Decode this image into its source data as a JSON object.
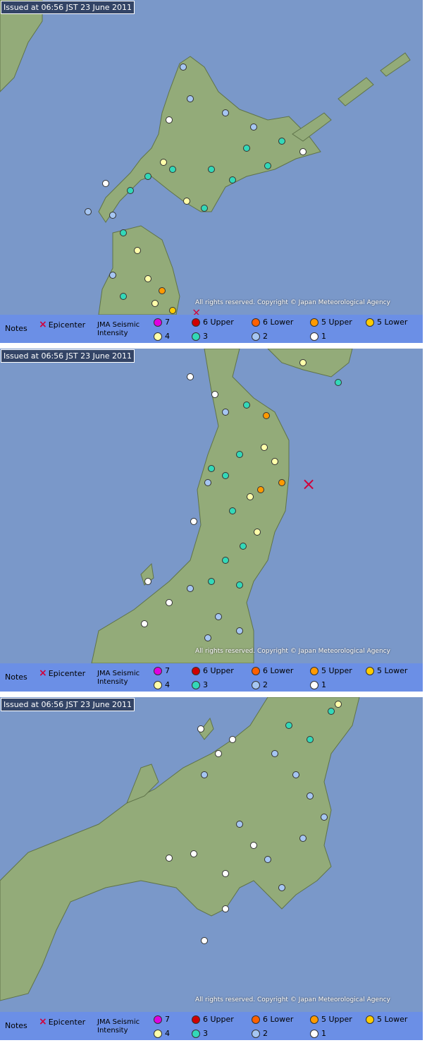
{
  "issued": "Issued at 06:56 JST  23 June 2011",
  "copyright": "All rights reserved. Copyright © Japan Meteorological Agency",
  "legend": {
    "notes": "Notes",
    "epicenter": "Epicenter",
    "jma_line1": "JMA Seismic",
    "jma_line2": "Intensity",
    "levels": [
      {
        "label": "7",
        "color": "#e000e0"
      },
      {
        "label": "6 Upper",
        "color": "#d00000"
      },
      {
        "label": "6 Lower",
        "color": "#ff6000"
      },
      {
        "label": "5 Upper",
        "color": "#ff9a00"
      },
      {
        "label": "5 Lower",
        "color": "#ffcc00"
      },
      {
        "label": "4",
        "color": "#ffffaa"
      },
      {
        "label": "3",
        "color": "#33d8b8"
      },
      {
        "label": "2",
        "color": "#a6c6f2"
      },
      {
        "label": "1",
        "color": "#ffffff"
      }
    ]
  },
  "colors": {
    "sea": "#7a98c9",
    "land": "#93ab79",
    "border": "#5f7349",
    "epicenter": "#d1003a"
  }
}
